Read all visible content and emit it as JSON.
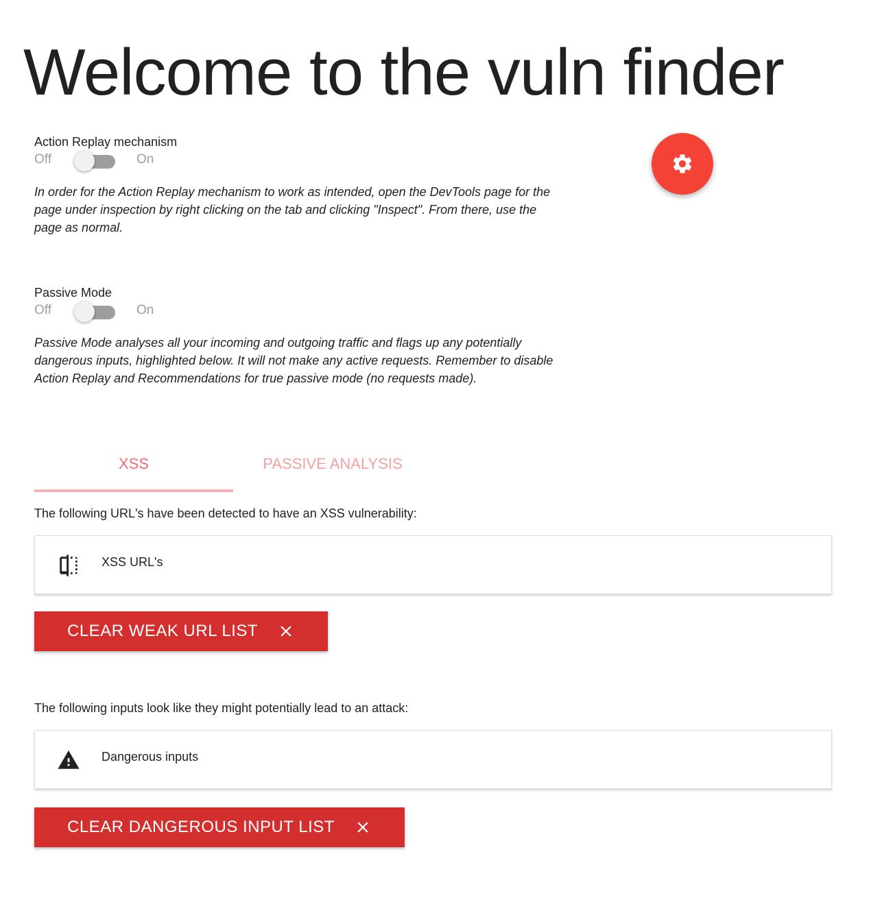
{
  "page": {
    "title": "Welcome to the vuln finder"
  },
  "action_replay": {
    "label": "Action Replay mechanism",
    "off_label": "Off",
    "on_label": "On",
    "enabled": false,
    "description": "In order for the Action Replay mechanism to work as intended, open the DevTools page for the page under inspection by right clicking on the tab and clicking \"Inspect\". From there, use the page as normal."
  },
  "passive_mode": {
    "label": "Passive Mode",
    "off_label": "Off",
    "on_label": "On",
    "enabled": false,
    "description": "Passive Mode analyses all your incoming and outgoing traffic and flags up any potentially dangerous inputs, highlighted below. It will not make any active requests. Remember to disable Action Replay and Recommendations for true passive mode (no requests made)."
  },
  "settings_fab": {
    "icon": "gear-icon",
    "color": "#f44336"
  },
  "tabs": [
    {
      "label": "XSS",
      "active": true
    },
    {
      "label": "Passive Analysis",
      "active": false
    }
  ],
  "xss_section": {
    "intro": "The following URL's have been detected to have an XSS vulnerability:",
    "collapsible_label": "XSS URL's",
    "collapsible_icon": "compare-icon",
    "clear_button_label": "Clear weak URL list",
    "clear_button_icon": "close-icon"
  },
  "inputs_section": {
    "intro": "The following inputs look like they might potentially lead to an attack:",
    "collapsible_label": "Dangerous inputs",
    "collapsible_icon": "warning-icon",
    "clear_button_label": "Clear dangerous input list",
    "clear_button_icon": "close-icon"
  },
  "colors": {
    "accent": "#f44336",
    "button": "#d32f2f",
    "tab_active": "#ee6e73",
    "tab_inactive": "#f3a1a5",
    "tab_indicator": "#f6b2b5"
  }
}
